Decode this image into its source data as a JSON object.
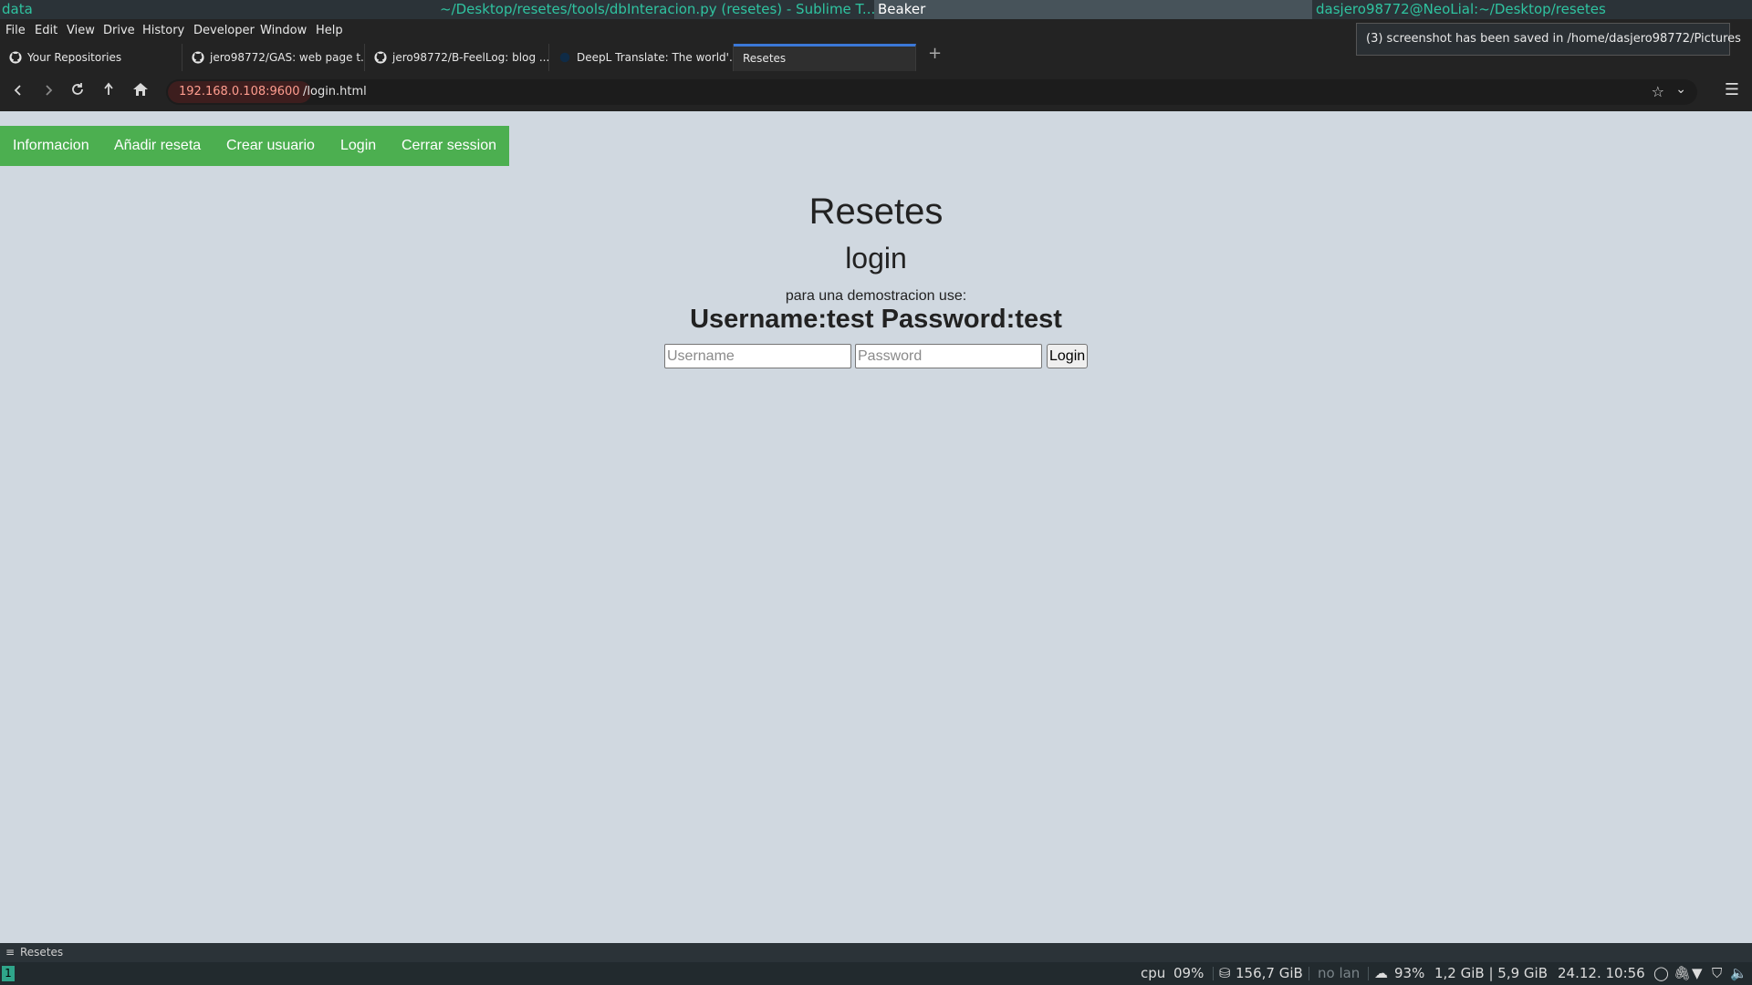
{
  "wm": {
    "left_title": "data",
    "sublime_title": "~/Desktop/resetes/tools/dbInteracion.py (resetes) - Sublime T...",
    "beaker_title": "Beaker",
    "terminal_title": "dasjero98772@NeoLial:~/Desktop/resetes"
  },
  "browser": {
    "menu": [
      "File",
      "Edit",
      "View",
      "Drive",
      "History",
      "Developer",
      "Window",
      "Help"
    ],
    "tabs": [
      {
        "label": "Your Repositories",
        "icon": "github-icon"
      },
      {
        "label": "jero98772/GAS: web page t...",
        "icon": "github-icon"
      },
      {
        "label": "jero98772/B-FeelLog: blog ...",
        "icon": "github-icon"
      },
      {
        "label": "DeepL Translate: The world'...",
        "icon": "deepl-icon"
      },
      {
        "label": "Resetes",
        "icon": ""
      }
    ],
    "new_tab_label": "+",
    "url_host": "192.168.0.108:9600",
    "url_path": "/login.html",
    "notification": "(3) screenshot has been saved in /home/dasjero98772/Pictures"
  },
  "site": {
    "nav": [
      "Informacion",
      "Añadir reseta",
      "Crear usuario",
      "Login",
      "Cerrar session"
    ],
    "title": "Resetes",
    "subtitle": "login",
    "demo_note": "para una demostracion use:",
    "demo_credentials": "Username:test Password:test",
    "username_placeholder": "Username",
    "password_placeholder": "Password",
    "login_button": "Login"
  },
  "bottom": {
    "window_label": "Resetes",
    "workspace": "1",
    "cpu_label": "cpu",
    "cpu_value": "09%",
    "disk": "156,7 GiB",
    "network": "no lan",
    "battery": "93%",
    "memory": "1,2 GiB | 5,9 GiB",
    "datetime": "24.12. 10:56"
  },
  "colors": {
    "accent_green": "#4caf50",
    "wm_teal": "#2fc3a0",
    "page_bg": "#d0d8e0"
  }
}
